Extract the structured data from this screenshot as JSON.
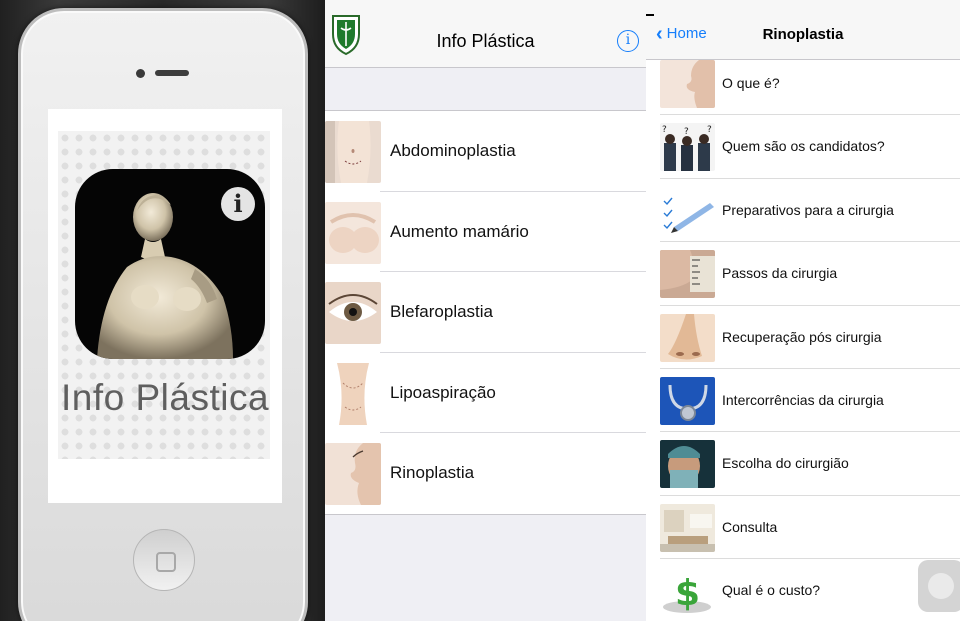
{
  "splash": {
    "phone_brand": "",
    "app_name": "Info Plástica",
    "icon_badge": "i"
  },
  "menu": {
    "title": "Info Plástica",
    "info_glyph": "i",
    "items": [
      {
        "label": "Abdominoplastia",
        "icon": "abdomen-photo"
      },
      {
        "label": "Aumento mamário",
        "icon": "breast-photo"
      },
      {
        "label": "Blefaroplastia",
        "icon": "eye-photo"
      },
      {
        "label": "Lipoaspiração",
        "icon": "waist-photo"
      },
      {
        "label": "Rinoplastia",
        "icon": "nose-profile-photo"
      }
    ]
  },
  "detail": {
    "back_label": "Home",
    "title": "Rinoplastia",
    "items": [
      {
        "label": "O que é?"
      },
      {
        "label": "Quem são os candidatos?"
      },
      {
        "label": "Preparativos para a cirurgia"
      },
      {
        "label": "Passos da cirurgia"
      },
      {
        "label": "Recuperação pós cirurgia"
      },
      {
        "label": "Intercorrências da cirurgia"
      },
      {
        "label": "Escolha do cirurgião"
      },
      {
        "label": "Consulta"
      },
      {
        "label": "Qual é o custo?"
      }
    ]
  },
  "colors": {
    "ios_blue": "#157efb",
    "table_background": "#efeff4",
    "separator": "#c8c7cc"
  }
}
